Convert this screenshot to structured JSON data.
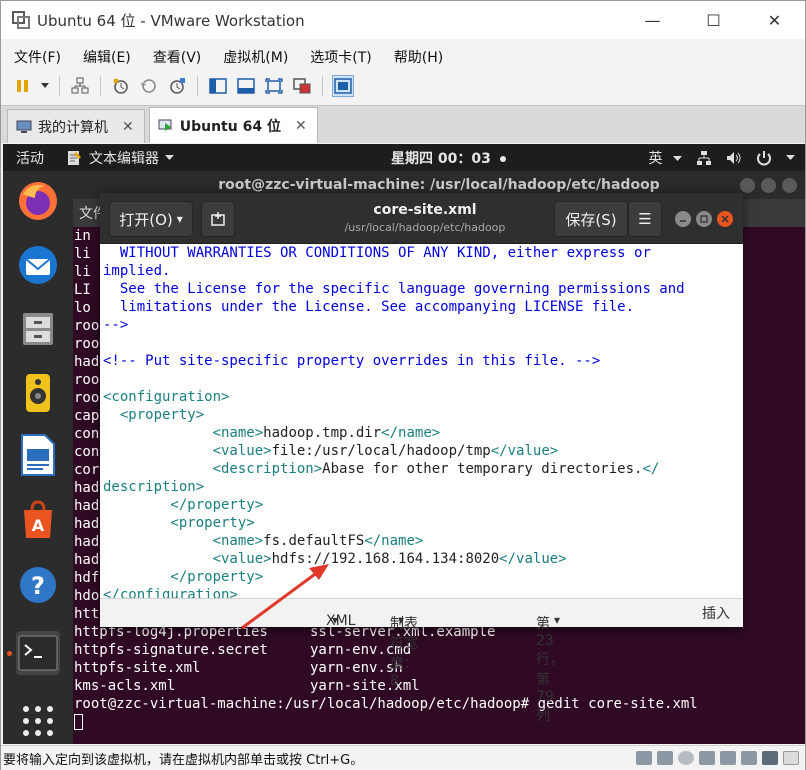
{
  "vm": {
    "title": "Ubuntu 64 位 - VMware Workstation",
    "controls": {
      "minimize": "—",
      "maximize": "☐",
      "close": "✕"
    },
    "menu": [
      "文件(F)",
      "编辑(E)",
      "查看(V)",
      "虚拟机(M)",
      "选项卡(T)",
      "帮助(H)"
    ],
    "tabs": [
      {
        "label": "我的计算机",
        "close": "✕"
      },
      {
        "label": "Ubuntu 64 位",
        "close": "✕"
      }
    ],
    "status_message": "要将输入定向到该虚拟机，请在虚拟机内部单击或按 Ctrl+G。"
  },
  "gnome": {
    "activities": "活动",
    "app_menu": "文本编辑器",
    "clock": "星期四 00：03",
    "input_method": "英"
  },
  "terminal": {
    "title": "root@zzc-virtual-machine: /usr/local/hadoop/etc/hadoop",
    "menu_label": "文件",
    "lines": [
      "in",
      "li",
      "li",
      "LI",
      "lo",
      "roo",
      "roo",
      "had",
      "roo",
      "roo",
      "cap",
      "con",
      "con",
      "cor",
      "had",
      "had",
      "had",
      "had",
      "had",
      "hdf",
      "hdo",
      "htt",
      "httpfs-log4j.properties     ssl-server.xml.example",
      "httpfs-signature.secret     yarn-env.cmd",
      "httpfs-site.xml             yarn-env.sh",
      "kms-acls.xml                yarn-site.xml",
      "root@zzc-virtual-machine:/usr/local/hadoop/etc/hadoop# gedit core-site.xml"
    ]
  },
  "gedit": {
    "open_label": "打开(O)",
    "open_arrow": "▾",
    "filename": "core-site.xml",
    "path": "/usr/local/hadoop/etc/hadoop",
    "save_label": "保存(S)",
    "menu_icon": "☰",
    "lines": [
      {
        "cls": "c-com",
        "text": "  WITHOUT WARRANTIES OR CONDITIONS OF ANY KIND, either express or"
      },
      {
        "cls": "c-com",
        "text": "implied."
      },
      {
        "cls": "c-com",
        "text": "  See the License for the specific language governing permissions and"
      },
      {
        "cls": "c-com",
        "text": "  limitations under the License. See accompanying LICENSE file."
      },
      {
        "cls": "c-com",
        "text": "-->"
      },
      {
        "cls": "c-txt",
        "text": ""
      },
      {
        "cls": "c-com",
        "text": "<!-- Put site-specific property overrides in this file. -->"
      },
      {
        "cls": "c-txt",
        "text": ""
      },
      {
        "cls": "c-tag",
        "text": "<configuration>"
      },
      {
        "cls": "c-tag",
        "text": "  <property>"
      },
      {
        "cls": "mixed",
        "parts": [
          [
            "c-txt",
            "             "
          ],
          [
            "c-tag",
            "<name>"
          ],
          [
            "c-txt",
            "hadoop.tmp.dir"
          ],
          [
            "c-tag",
            "</name>"
          ]
        ]
      },
      {
        "cls": "mixed",
        "parts": [
          [
            "c-txt",
            "             "
          ],
          [
            "c-tag",
            "<value>"
          ],
          [
            "c-txt",
            "file:/usr/local/hadoop/tmp"
          ],
          [
            "c-tag",
            "</value>"
          ]
        ]
      },
      {
        "cls": "mixed",
        "parts": [
          [
            "c-txt",
            "             "
          ],
          [
            "c-tag",
            "<description>"
          ],
          [
            "c-txt",
            "Abase for other temporary directories."
          ],
          [
            "c-tag",
            "</"
          ]
        ]
      },
      {
        "cls": "c-tag",
        "text": "description>"
      },
      {
        "cls": "c-tag",
        "text": "        </property>"
      },
      {
        "cls": "c-tag",
        "text": "        <property>"
      },
      {
        "cls": "mixed",
        "parts": [
          [
            "c-txt",
            "             "
          ],
          [
            "c-tag",
            "<name>"
          ],
          [
            "c-txt",
            "fs.defaultFS"
          ],
          [
            "c-tag",
            "</name>"
          ]
        ]
      },
      {
        "cls": "mixed",
        "parts": [
          [
            "c-txt",
            "             "
          ],
          [
            "c-tag",
            "<value>"
          ],
          [
            "c-txt",
            "hdfs://192.168.164.134:8020"
          ],
          [
            "c-tag",
            "</value>"
          ]
        ]
      },
      {
        "cls": "c-tag",
        "text": "        </property>"
      },
      {
        "cls": "c-tag",
        "text": "</configuration>"
      }
    ],
    "status": {
      "language": "XML",
      "tab_width": "制表符宽度：8",
      "position": "第 23 行，第 79 列",
      "mode": "插入",
      "dropdown": "▾"
    }
  },
  "colors": {
    "terminal_bg": "#300a24",
    "accent": "#e95420",
    "arrow": "#e0392b"
  }
}
